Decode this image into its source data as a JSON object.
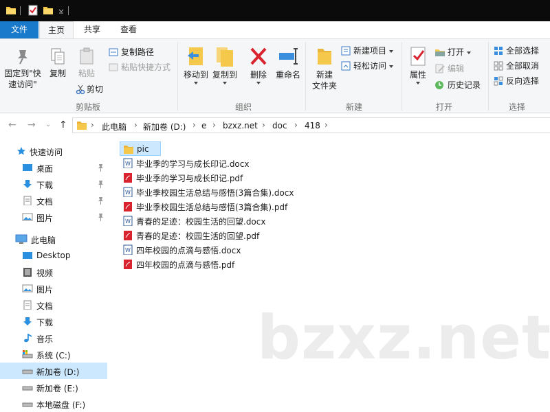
{
  "ribbon_tabs": {
    "file": "文件",
    "home": "主页",
    "share": "共享",
    "view": "查看"
  },
  "ribbon": {
    "clipboard": {
      "pin_quick_access": "固定到\"快\n速访问\"",
      "copy": "复制",
      "paste": "粘贴",
      "copy_path": "复制路径",
      "paste_shortcut": "粘贴快捷方式",
      "cut": "剪切",
      "label": "剪贴板"
    },
    "organize": {
      "move_to": "移动到",
      "copy_to": "复制到",
      "delete": "删除",
      "rename": "重命名",
      "label": "组织"
    },
    "new": {
      "new_folder": "新建\n文件夹",
      "new_item": "新建项目",
      "easy_access": "轻松访问",
      "label": "新建"
    },
    "open": {
      "properties": "属性",
      "open": "打开",
      "edit": "编辑",
      "history": "历史记录",
      "label": "打开"
    },
    "select": {
      "select_all": "全部选择",
      "select_none": "全部取消",
      "invert": "反向选择",
      "label": "选择"
    }
  },
  "address": {
    "crumbs": [
      "此电脑",
      "新加卷 (D:)",
      "e",
      "bzxz.net",
      "doc",
      "418"
    ]
  },
  "nav": {
    "quick_access": "快速访问",
    "desktop": "桌面",
    "downloads": "下载",
    "documents": "文档",
    "pictures": "图片",
    "this_pc": "此电脑",
    "pc_desktop": "Desktop",
    "videos": "视频",
    "pc_pictures": "图片",
    "pc_documents": "文档",
    "pc_downloads": "下载",
    "music": "音乐",
    "drive_c": "系统 (C:)",
    "drive_d": "新加卷 (D:)",
    "drive_e": "新加卷 (E:)",
    "drive_f": "本地磁盘 (F:)"
  },
  "files": [
    {
      "name": "pic",
      "type": "folder"
    },
    {
      "name": "毕业季的学习与成长印记.docx",
      "type": "docx"
    },
    {
      "name": "毕业季的学习与成长印记.pdf",
      "type": "pdf"
    },
    {
      "name": "毕业季校园生活总结与感悟(3篇合集).docx",
      "type": "docx"
    },
    {
      "name": "毕业季校园生活总结与感悟(3篇合集).pdf",
      "type": "pdf"
    },
    {
      "name": "青春的足迹：校园生活的回望.docx",
      "type": "docx"
    },
    {
      "name": "青春的足迹：校园生活的回望.pdf",
      "type": "pdf"
    },
    {
      "name": "四年校园的点滴与感悟.docx",
      "type": "docx"
    },
    {
      "name": "四年校园的点滴与感悟.pdf",
      "type": "pdf"
    }
  ],
  "watermark": "bzxz.net",
  "colors": {
    "accent": "#1979ca",
    "selection": "#cce8ff",
    "folder": "#f5c84c",
    "pdf": "#d9232e",
    "docx": "#2b5797"
  }
}
